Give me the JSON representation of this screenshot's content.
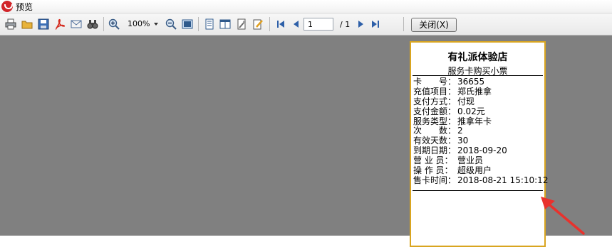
{
  "window": {
    "title": "预览"
  },
  "toolbar": {
    "zoom": "100%",
    "page_current": "1",
    "page_total": "/ 1",
    "close_label": "关闭(X)"
  },
  "receipt": {
    "shop_name": "有礼派体验店",
    "subtitle": "服务卡购买小票",
    "rows": [
      {
        "label": "卡　　号：",
        "value": "36655"
      },
      {
        "label": "充值项目：",
        "value": "郑氏推拿"
      },
      {
        "label": "支付方式：",
        "value": "付现"
      },
      {
        "label": "支付金额：",
        "value": "0.02元"
      },
      {
        "label": "服务类型：",
        "value": "推拿年卡"
      },
      {
        "label": "次　　数：",
        "value": "2"
      },
      {
        "label": "有效天数：",
        "value": "30"
      },
      {
        "label": "到期日期：",
        "value": "2018-09-20"
      },
      {
        "label": "营 业 员：",
        "value": "营业员"
      },
      {
        "label": "操 作 员：",
        "value": "超级用户"
      },
      {
        "label": "售卡时间：",
        "value": "2018-08-21 15:10:12"
      }
    ]
  },
  "colors": {
    "workspace": "#808080",
    "receipt_border": "#d9a520",
    "arrow": "#e8322d"
  }
}
